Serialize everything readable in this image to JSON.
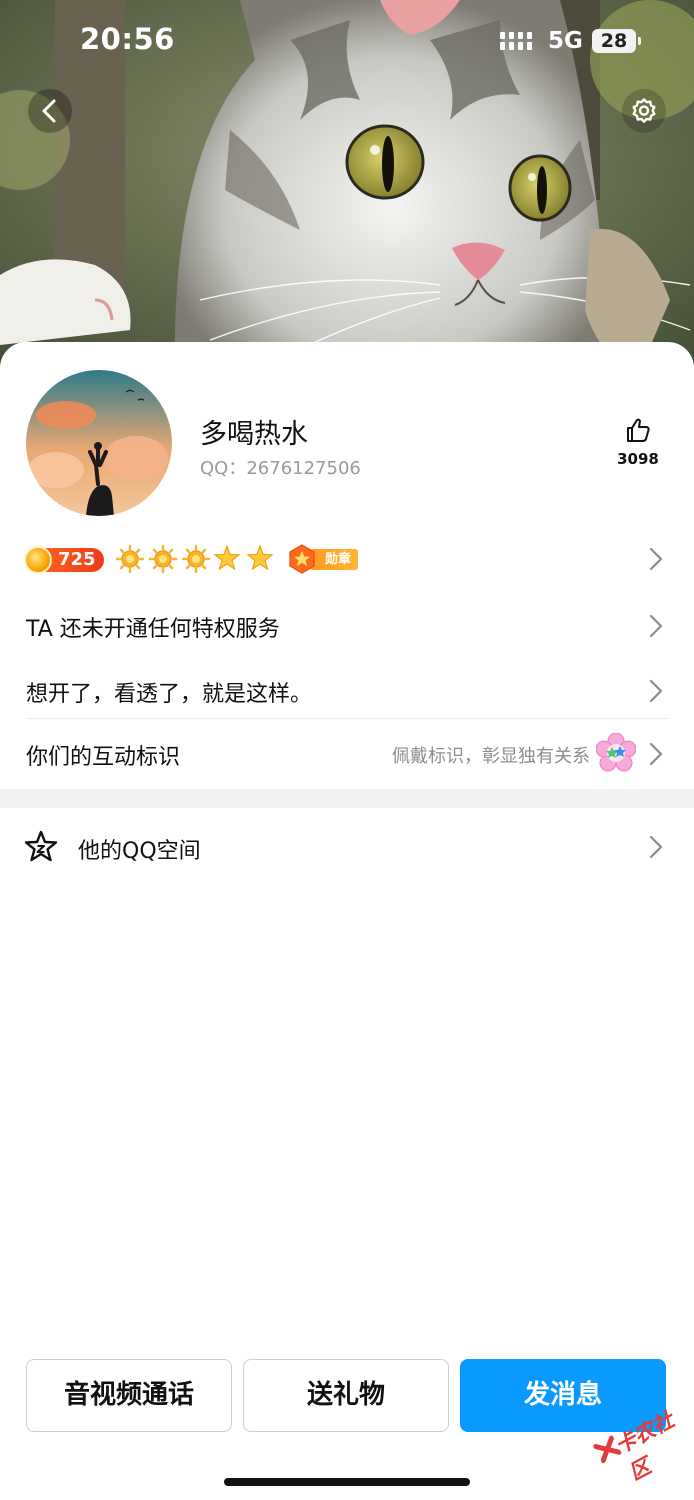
{
  "status_bar": {
    "time": "20:56",
    "network": "5G",
    "battery": "28"
  },
  "profile": {
    "nickname": "多喝热水",
    "qq_label": "QQ：",
    "qq_number": "2676127506",
    "like_count": "3098",
    "level": "725",
    "medal_label": "勋章",
    "level_icons": [
      "sun-icon",
      "sun-icon",
      "sun-icon",
      "star-icon",
      "star-icon"
    ]
  },
  "rows": {
    "privilege": "TA 还未开通任何特权服务",
    "signature": "想开了，看透了，就是这样。",
    "interaction_label": "你们的互动标识",
    "interaction_hint": "佩戴标识，彰显独有关系",
    "qzone": "他的QQ空间"
  },
  "actions": {
    "call": "音视频通话",
    "gift": "送礼物",
    "message": "发消息"
  },
  "watermark": "卡农社区",
  "colors": {
    "primary": "#0A99FF",
    "level_badge": "#F03A1A",
    "medal": "#FFB732"
  }
}
